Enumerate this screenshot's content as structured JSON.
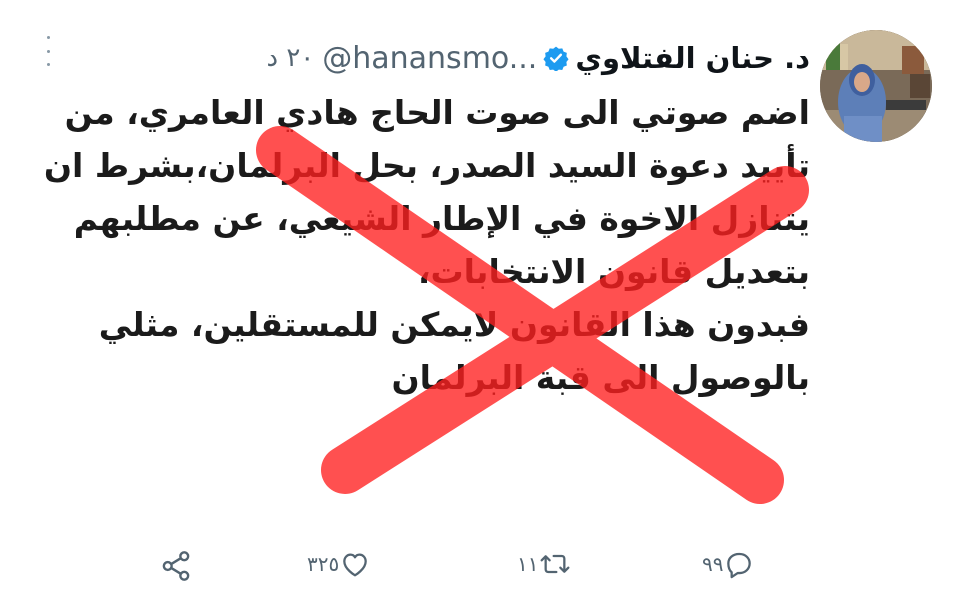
{
  "tweet": {
    "display_name": "د. حنان الفتلاوي",
    "handle": "@hanansmo...",
    "time": "٢٠ د",
    "verified": true,
    "lines": [
      "اضم صوتي الى صوت الحاج هادي العامري، من",
      "تأييد دعوة السيد الصدر، بحل البرلمان،بشرط ان",
      "يتنازل الاخوة في الإطار الشيعي، عن مطلبهم",
      "بتعديل قانون الانتخابات،",
      "فبدون هذا القانون لايمكن للمستقلين، مثلي",
      "بالوصول الى قبة البرلمان"
    ]
  },
  "actions": {
    "reply_count": "٩٩",
    "retweet_count": "١١",
    "like_count": "٣٢٥"
  },
  "icons": {
    "verified": "verified-badge-icon",
    "reply": "reply-icon",
    "retweet": "retweet-icon",
    "like": "heart-icon",
    "share": "share-icon",
    "more": "more-options-icon"
  },
  "colors": {
    "verified_blue": "#1d9bf0",
    "icon_gray": "#536471",
    "cross_red": "#ff2a2a"
  }
}
